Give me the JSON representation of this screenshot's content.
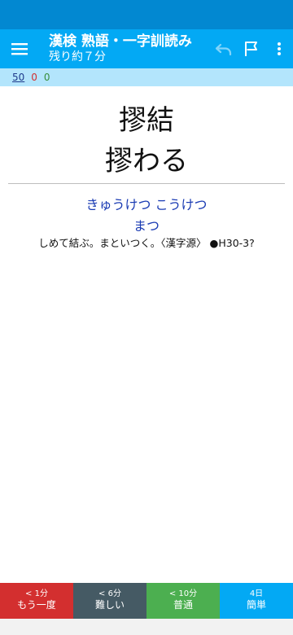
{
  "app_bar": {
    "title": "漢検 熟語・一字訓読み",
    "subtitle": "残り約７分",
    "icons": [
      "menu-icon",
      "undo-icon",
      "flag-icon",
      "more-vert-icon"
    ],
    "accent_color": "#03a9f4"
  },
  "counter": {
    "total": "50",
    "wrong": "0",
    "right": "0"
  },
  "question": {
    "line1": "摎結",
    "line2": "摎わる"
  },
  "answer": {
    "reading_line1": "きゅうけつ こうけつ",
    "reading_line2": "まつ",
    "explanation": "しめて結ぶ。まといつく。〈漢字源〉 ●H30-3?"
  },
  "grade_buttons": [
    {
      "interval": "< 1分",
      "label": "もう一度",
      "color": "#d32f2f"
    },
    {
      "interval": "< 6分",
      "label": "難しい",
      "color": "#455a64"
    },
    {
      "interval": "< 10分",
      "label": "普通",
      "color": "#4caf50"
    },
    {
      "interval": "4日",
      "label": "簡単",
      "color": "#03a9f4"
    }
  ]
}
